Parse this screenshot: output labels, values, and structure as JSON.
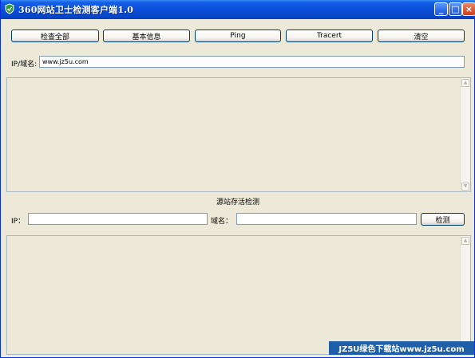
{
  "window": {
    "title": "360网站卫士检测客户端1.0",
    "controls": {
      "minimize": "_",
      "maximize": "□",
      "close": "×"
    }
  },
  "toolbar": {
    "buttons": [
      {
        "label": "检查全部"
      },
      {
        "label": "基本信息"
      },
      {
        "label": "Ping"
      },
      {
        "label": "Tracert"
      },
      {
        "label": "清空"
      }
    ]
  },
  "target": {
    "label": "IP/域名:",
    "value": "www.jz5u.com"
  },
  "origin_check": {
    "section_title": "源站存活检测",
    "ip_label": "IP：",
    "ip_value": "",
    "domain_label": "域名：",
    "domain_value": "",
    "check_button": "检测"
  },
  "watermark": {
    "text": "JZ5U绿色下载站www.jz5u.com"
  },
  "colors": {
    "titlebar": "#0A4FD8",
    "window_bg": "#ECE9D8",
    "button_border": "#003C74",
    "watermark_bg": "#1F5FA8"
  },
  "icons": {
    "app": "shield-icon",
    "scroll_up": "arrow-up-icon",
    "scroll_down": "arrow-down-icon"
  }
}
